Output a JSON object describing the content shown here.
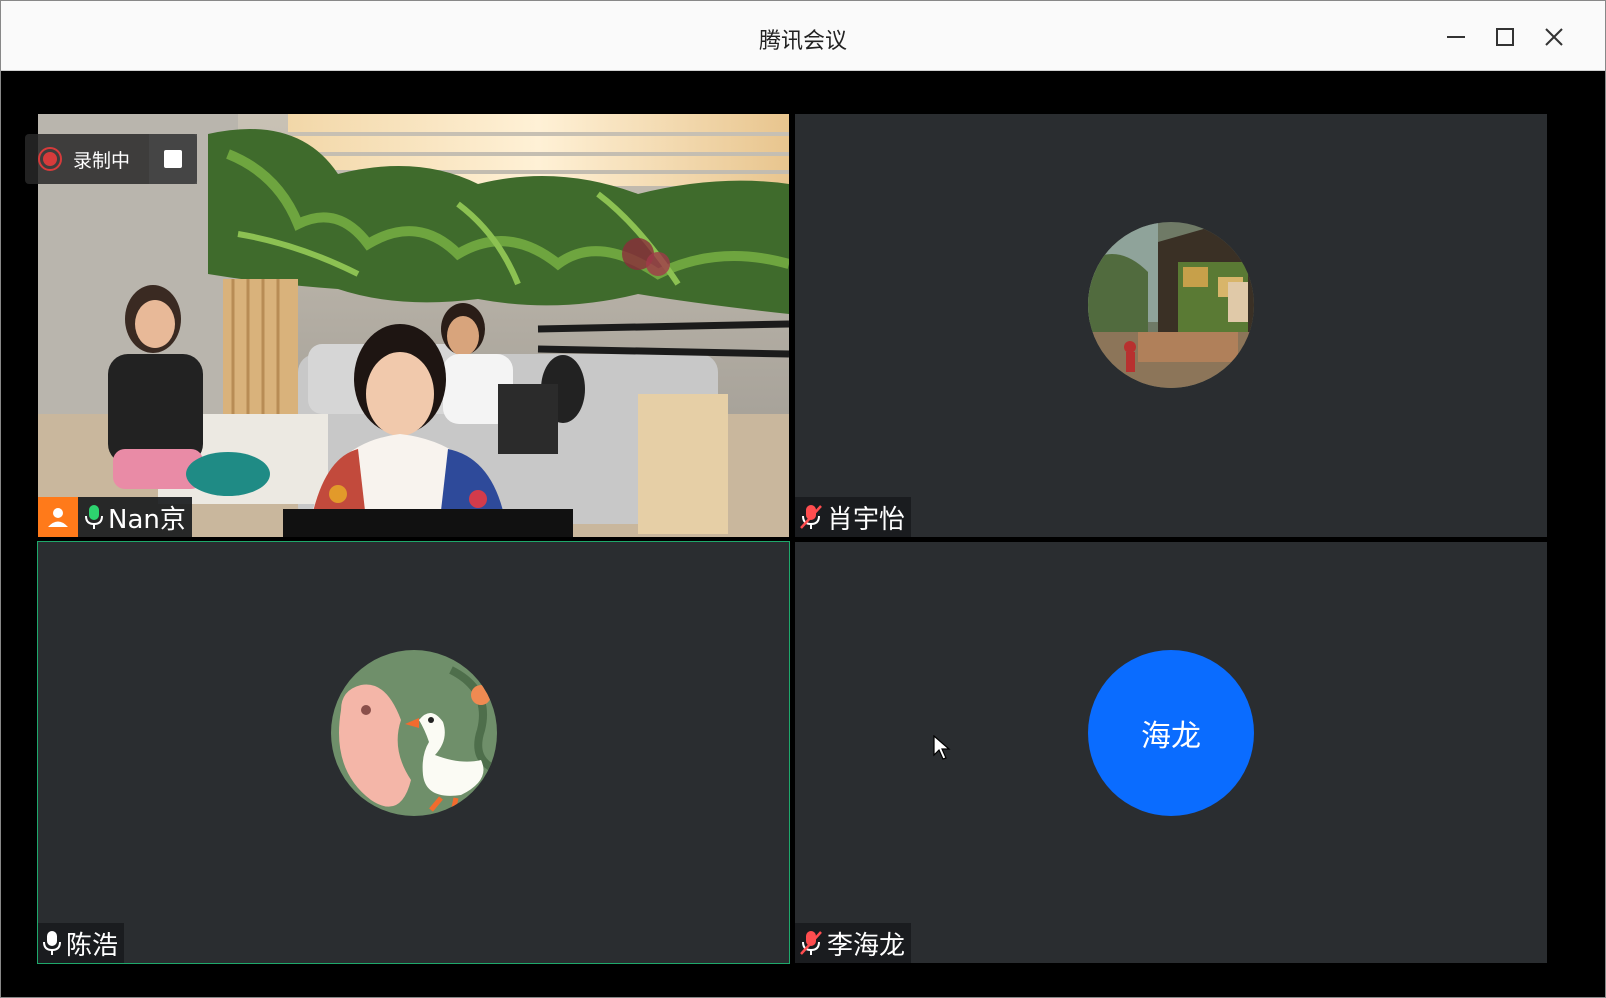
{
  "window": {
    "title": "腾讯会议",
    "minimize_icon": "minimize-icon",
    "maximize_icon": "maximize-icon",
    "close_icon": "close-icon"
  },
  "recording": {
    "label": "录制中",
    "status_icon": "record-dot-icon",
    "stop_icon": "stop-square-icon"
  },
  "participants": [
    {
      "name": "Nan京",
      "mic": "on",
      "host": true,
      "video": "on"
    },
    {
      "name": "肖宇怡",
      "mic": "muted",
      "avatar": "photo-street"
    },
    {
      "name": "陈浩",
      "mic": "on",
      "avatar": "illustration-goose",
      "active_speaker": true
    },
    {
      "name": "李海龙",
      "mic": "muted",
      "avatar_text": "海龙",
      "avatar_color": "#0a6cff"
    }
  ],
  "colors": {
    "host_badge": "#ff7a1a",
    "active_border": "#1ea86b",
    "mic_on": "#2dd36f",
    "mic_muted": "#ff4d4f",
    "tile_bg": "#2a2d30"
  }
}
